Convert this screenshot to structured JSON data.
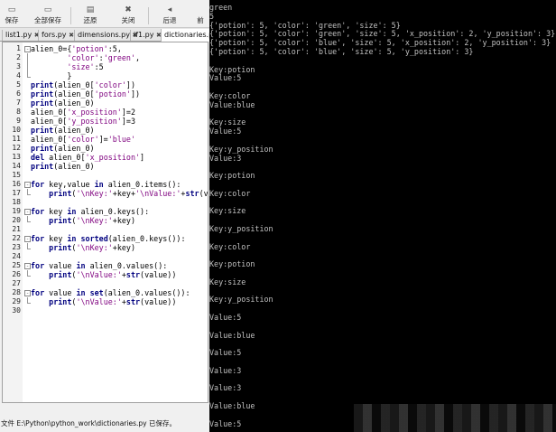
{
  "toolbar": {
    "buttons": [
      {
        "icon": "save-icon",
        "glyph": "▭",
        "label": "保存"
      },
      {
        "icon": "save-all-icon",
        "glyph": "▭",
        "label": "全部保存"
      },
      {
        "icon": "restore-icon",
        "glyph": "▤",
        "label": "还原"
      },
      {
        "icon": "close-icon",
        "glyph": "✖",
        "label": "关闭"
      },
      {
        "icon": "back-icon",
        "glyph": "◂",
        "label": "后退"
      },
      {
        "icon": "forward-icon",
        "glyph": "",
        "label": "前"
      }
    ]
  },
  "tabs": [
    {
      "label": "list1.py",
      "close": "✖"
    },
    {
      "label": "fors.py",
      "close": "✖"
    },
    {
      "label": "dimensions.py",
      "close": "✖"
    },
    {
      "label": "if1.py",
      "close": "✖"
    },
    {
      "label": "dictionaries.py",
      "close": "✖",
      "active": true
    }
  ],
  "editor": {
    "lines": [
      {
        "n": "1",
        "fold": "open",
        "html": "alien_0={<span class=\"st\">'potion'</span>:5,"
      },
      {
        "n": "2",
        "fold": "bar",
        "html": "        <span class=\"st\">'color'</span>:<span class=\"st\">'green'</span>,"
      },
      {
        "n": "3",
        "fold": "bar",
        "html": "        <span class=\"st\">'size'</span>:5"
      },
      {
        "n": "4",
        "fold": "end",
        "html": "        }"
      },
      {
        "n": "5",
        "fold": "",
        "html": "<span class=\"kw\">print</span>(alien_0[<span class=\"st\">'color'</span>])"
      },
      {
        "n": "6",
        "fold": "",
        "html": "<span class=\"kw\">print</span>(alien_0[<span class=\"st\">'potion'</span>])"
      },
      {
        "n": "7",
        "fold": "",
        "html": "<span class=\"kw\">print</span>(alien_0)"
      },
      {
        "n": "8",
        "fold": "",
        "html": "alien_0[<span class=\"st\">'x_position'</span>]=2"
      },
      {
        "n": "9",
        "fold": "",
        "html": "alien_0[<span class=\"st\">'y_position'</span>]=3"
      },
      {
        "n": "10",
        "fold": "",
        "html": "<span class=\"kw\">print</span>(alien_0)"
      },
      {
        "n": "11",
        "fold": "",
        "html": "alien_0[<span class=\"st\">'color'</span>]=<span class=\"st\">'blue'</span>"
      },
      {
        "n": "12",
        "fold": "",
        "html": "<span class=\"kw\">print</span>(alien_0)"
      },
      {
        "n": "13",
        "fold": "",
        "html": "<span class=\"kw\">del</span> alien_0[<span class=\"st\">'x_position'</span>]"
      },
      {
        "n": "14",
        "fold": "",
        "html": "<span class=\"kw\">print</span>(alien_0)"
      },
      {
        "n": "15",
        "fold": "",
        "html": ""
      },
      {
        "n": "16",
        "fold": "open",
        "html": "<span class=\"kw\">for</span> key,value <span class=\"kw\">in</span> alien_0.items():"
      },
      {
        "n": "17",
        "fold": "end",
        "html": "    <span class=\"kw\">print</span>(<span class=\"st\">'\\nKey:'</span>+key+<span class=\"st\">'\\nValue:'</span>+<span class=\"kw\">str</span>(va"
      },
      {
        "n": "18",
        "fold": "",
        "html": ""
      },
      {
        "n": "19",
        "fold": "open",
        "html": "<span class=\"kw\">for</span> key <span class=\"kw\">in</span> alien_0.keys():"
      },
      {
        "n": "20",
        "fold": "end",
        "html": "    <span class=\"kw\">print</span>(<span class=\"st\">'\\nKey:'</span>+key)"
      },
      {
        "n": "21",
        "fold": "",
        "html": ""
      },
      {
        "n": "22",
        "fold": "open",
        "html": "<span class=\"kw\">for</span> key <span class=\"kw\">in</span> <span class=\"kw\">sorted</span>(alien_0.keys()):"
      },
      {
        "n": "23",
        "fold": "end",
        "html": "    <span class=\"kw\">print</span>(<span class=\"st\">'\\nKey:'</span>+key)"
      },
      {
        "n": "24",
        "fold": "",
        "html": ""
      },
      {
        "n": "25",
        "fold": "open",
        "html": "<span class=\"kw\">for</span> value <span class=\"kw\">in</span> alien_0.values():"
      },
      {
        "n": "26",
        "fold": "end",
        "html": "    <span class=\"kw\">print</span>(<span class=\"st\">'\\nValue:'</span>+<span class=\"kw\">str</span>(value))"
      },
      {
        "n": "27",
        "fold": "",
        "html": ""
      },
      {
        "n": "28",
        "fold": "open",
        "html": "<span class=\"kw\">for</span> value <span class=\"kw\">in</span> <span class=\"kw\">set</span>(alien_0.values()):"
      },
      {
        "n": "29",
        "fold": "end",
        "html": "    <span class=\"kw\">print</span>(<span class=\"st\">'\\nValue:'</span>+<span class=\"kw\">str</span>(value))"
      },
      {
        "n": "30",
        "fold": "",
        "html": ""
      }
    ]
  },
  "status_bar": {
    "text": "文件 E:\\Python\\python_work\\dictionaries.py 已保存。"
  },
  "terminal": {
    "lines": [
      "green",
      "5",
      "{'potion': 5, 'color': 'green', 'size': 5}",
      "{'potion': 5, 'color': 'green', 'size': 5, 'x_position': 2, 'y_position': 3}",
      "{'potion': 5, 'color': 'blue', 'size': 5, 'x_position': 2, 'y_position': 3}",
      "{'potion': 5, 'color': 'blue', 'size': 5, 'y_position': 3}",
      "",
      "Key:potion",
      "Value:5",
      "",
      "Key:color",
      "Value:blue",
      "",
      "Key:size",
      "Value:5",
      "",
      "Key:y_position",
      "Value:3",
      "",
      "Key:potion",
      "",
      "Key:color",
      "",
      "Key:size",
      "",
      "Key:y_position",
      "",
      "Key:color",
      "",
      "Key:potion",
      "",
      "Key:size",
      "",
      "Key:y_position",
      "",
      "Value:5",
      "",
      "Value:blue",
      "",
      "Value:5",
      "",
      "Value:3",
      "",
      "Value:3",
      "",
      "Value:blue",
      "",
      "Value:5"
    ]
  }
}
